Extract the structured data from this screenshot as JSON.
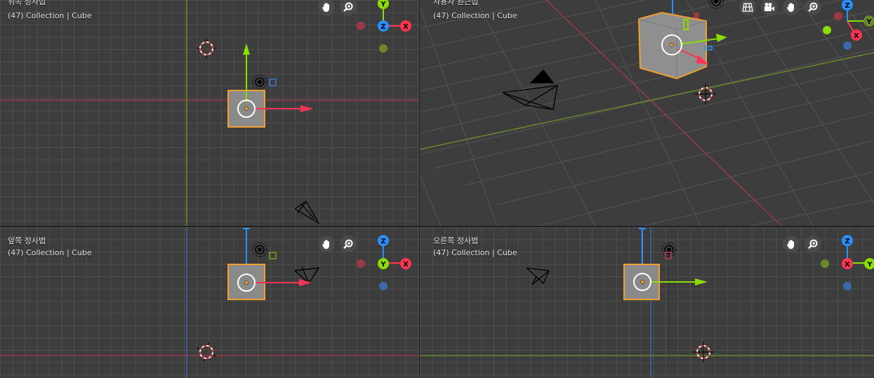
{
  "viewports": {
    "top": {
      "title": "위쪽 정사법",
      "subtitle": "(47) Collection | Cube"
    },
    "perspective": {
      "title": "사용자 원근법",
      "subtitle": "(47) Collection | Cube"
    },
    "front": {
      "title": "앞쪽 정사법",
      "subtitle": "(47) Collection | Cube"
    },
    "right": {
      "title": "오른쪽 정사법",
      "subtitle": "(47) Collection | Cube"
    }
  },
  "gizmo": {
    "x": "X",
    "y": "Y",
    "z": "Z"
  },
  "colors": {
    "x_axis": "#ff3352",
    "y_axis": "#8bdc00",
    "z_axis": "#2890ff",
    "x_line": "#9a3a46",
    "y_line": "#6a8a2a",
    "z_line": "#3a6aa8",
    "selection": "#f0a030",
    "cube": "#8a8a8a",
    "grid_bg": "#3d3d3d"
  },
  "icons": [
    "hand-pan-icon",
    "zoom-icon",
    "camera-view-icon",
    "ortho-grid-icon"
  ]
}
